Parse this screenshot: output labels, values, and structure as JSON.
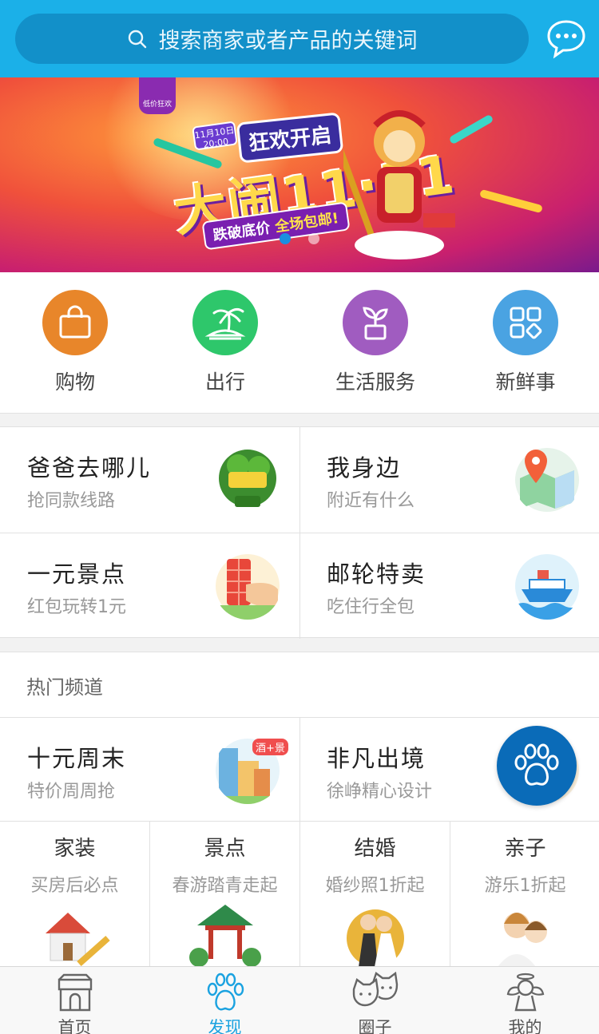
{
  "search": {
    "placeholder": "搜索商家或者产品的关键词"
  },
  "banner": {
    "badge": "低价狂欢",
    "date_tag": "11月10日 20:00",
    "kickoff": "狂欢开启",
    "headline": "大闹11·11",
    "subline_a": "跌破底价",
    "subline_b": "全场包邮!",
    "active_slide": 1,
    "slide_count": 2
  },
  "categories": [
    {
      "label": "购物",
      "icon": "shopping-bag-icon",
      "color": "#e8862a"
    },
    {
      "label": "出行",
      "icon": "palm-island-icon",
      "color": "#2ec76b"
    },
    {
      "label": "生活服务",
      "icon": "plant-pot-icon",
      "color": "#a05cc0"
    },
    {
      "label": "新鲜事",
      "icon": "apps-grid-icon",
      "color": "#4aa3e2"
    }
  ],
  "features": [
    {
      "title": "爸爸去哪儿",
      "subtitle": "抢同款线路",
      "icon": "show-logo-icon"
    },
    {
      "title": "我身边",
      "subtitle": "附近有什么",
      "icon": "map-pin-icon"
    },
    {
      "title": "一元景点",
      "subtitle": "红包玩转1元",
      "icon": "red-packet-icon"
    },
    {
      "title": "邮轮特卖",
      "subtitle": "吃住行全包",
      "icon": "cruise-ship-icon"
    }
  ],
  "hot": {
    "section_title": "热门频道",
    "items": [
      {
        "title": "十元周末",
        "subtitle": "特价周周抢",
        "tag": "酒+景",
        "icon": "city-buildings-icon"
      },
      {
        "title": "非凡出境",
        "subtitle": "徐峥精心设计",
        "icon": "travel-suitcase-icon"
      }
    ]
  },
  "quad": [
    {
      "title": "家装",
      "subtitle": "买房后必点",
      "icon": "house-icon"
    },
    {
      "title": "景点",
      "subtitle": "春游踏青走起",
      "icon": "pavilion-icon"
    },
    {
      "title": "结婚",
      "subtitle": "婚纱照1折起",
      "icon": "wedding-couple-icon"
    },
    {
      "title": "亲子",
      "subtitle": "游乐1折起",
      "icon": "mother-child-icon"
    }
  ],
  "tabs": [
    {
      "label": "首页",
      "icon": "store-icon"
    },
    {
      "label": "发现",
      "icon": "paw-icon",
      "active": true
    },
    {
      "label": "圈子",
      "icon": "cats-icon"
    },
    {
      "label": "我的",
      "icon": "angel-icon"
    }
  ],
  "colors": {
    "header": "#1bb0e8",
    "accent": "#1aa2e0",
    "fab": "#0a6bb8"
  }
}
